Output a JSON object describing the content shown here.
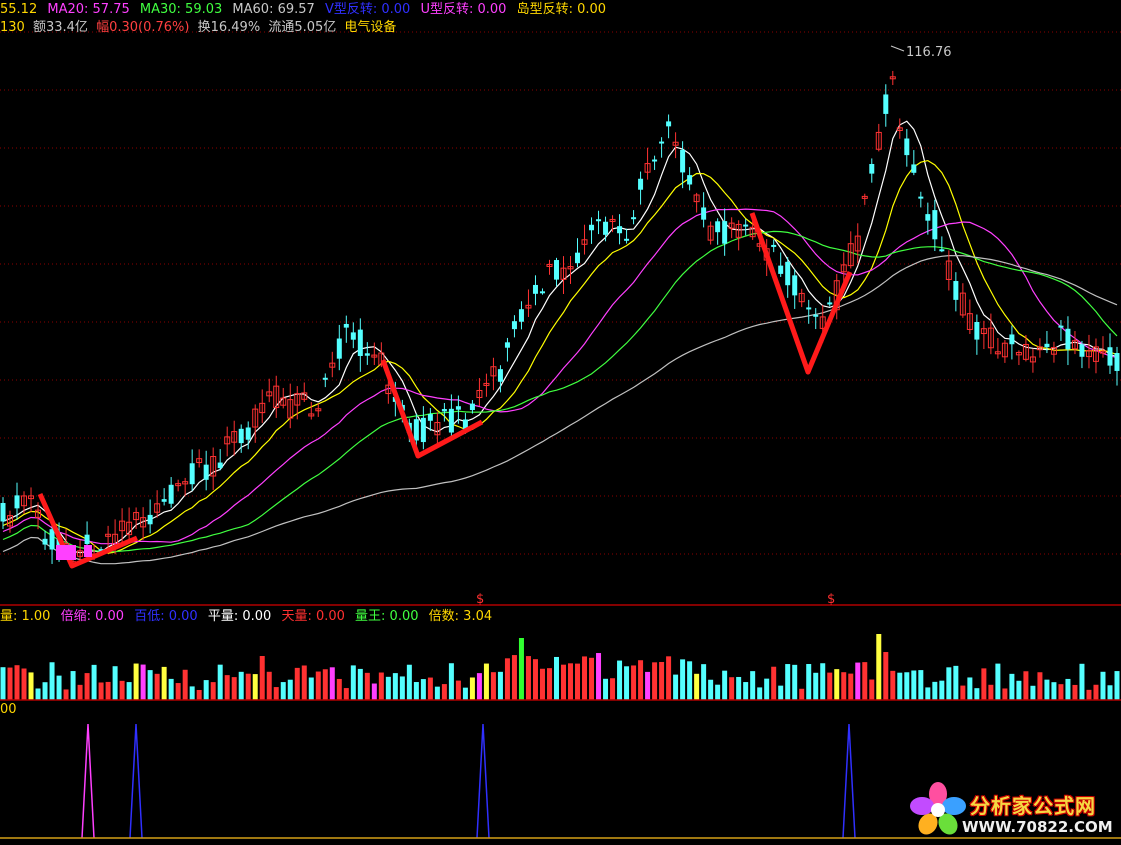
{
  "header_price": {
    "items": [
      {
        "label": "55.12",
        "color": "#ffd700"
      },
      {
        "label": "MA20: 57.75",
        "color": "#ff40ff"
      },
      {
        "label": "MA30: 59.03",
        "color": "#40ff40"
      },
      {
        "label": "MA60: 69.57",
        "color": "#c8c8c8"
      },
      {
        "label": "V型反转: 0.00",
        "color": "#3030ff"
      },
      {
        "label": "U型反转: 0.00",
        "color": "#ff40ff"
      },
      {
        "label": "岛型反转: 0.00",
        "color": "#ffd700"
      }
    ]
  },
  "header_info": {
    "items": [
      {
        "label": "130",
        "color": "#ffd700"
      },
      {
        "label": "额33.4亿",
        "color": "#c8c8c8"
      },
      {
        "label": "幅",
        "color": "#ff4040"
      },
      {
        "label": "0.30(0.76%)",
        "color": "#ff4040"
      },
      {
        "label": "换16.49%",
        "color": "#c8c8c8"
      },
      {
        "label": "流通5.05亿",
        "color": "#c8c8c8"
      },
      {
        "label": "电气设备",
        "color": "#ffd700"
      }
    ]
  },
  "price_chart": {
    "peak_label": "116.76",
    "signal_markers": [
      "$",
      "$"
    ]
  },
  "volume_header": {
    "items": [
      {
        "label": "量: 1.00",
        "color": "#ffd700"
      },
      {
        "label": "倍缩: 0.00",
        "color": "#ff40ff"
      },
      {
        "label": "百低: 0.00",
        "color": "#3030ff"
      },
      {
        "label": "平量: 0.00",
        "color": "#ffffff"
      },
      {
        "label": "天量: 0.00",
        "color": "#ff3030"
      },
      {
        "label": "量王: 0.00",
        "color": "#40ff40"
      },
      {
        "label": "倍数: 3.04",
        "color": "#ffd700"
      }
    ]
  },
  "indicator_header": {
    "value": "00"
  },
  "watermark": {
    "title": "分析家公式网",
    "url": "WWW.70822.COM"
  },
  "colors": {
    "up": "#ff3232",
    "down": "#54ffff",
    "ma5": "#ffffff",
    "ma10": "#ffff00",
    "ma20": "#ff40ff",
    "ma30": "#40ff40",
    "ma60": "#c0c0c0",
    "pattern": "#ff1a1a",
    "grid": "#8b0000"
  }
}
